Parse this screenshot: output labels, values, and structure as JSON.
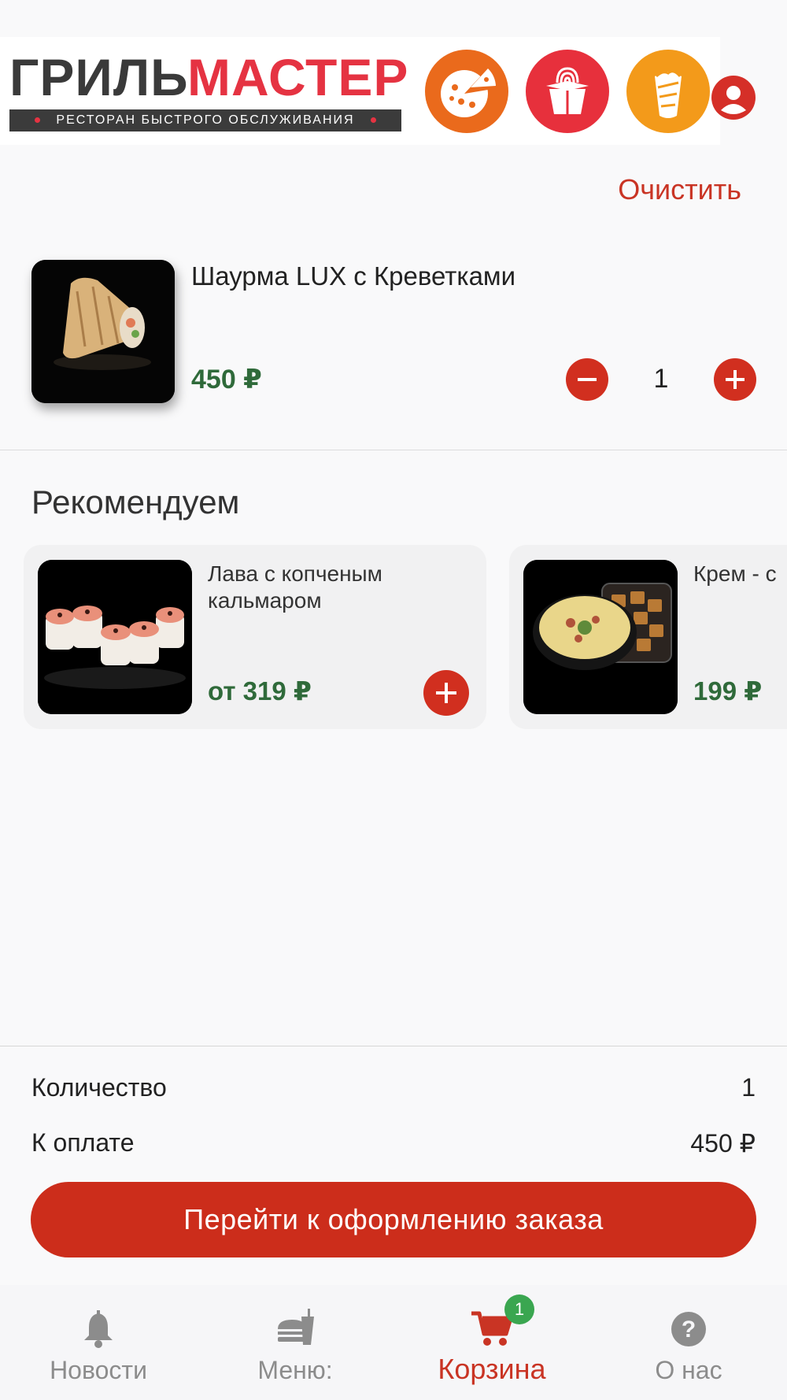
{
  "header": {
    "logo_part1": "ГРИЛЬ",
    "logo_part2": "МАСТЕР",
    "logo_subtitle": "РЕСТОРАН БЫСТРОГО ОБСЛУЖИВАНИЯ",
    "categories": [
      {
        "icon": "pizza-icon",
        "color": "#ea6a1c"
      },
      {
        "icon": "noodle-box-icon",
        "color": "#e7303c"
      },
      {
        "icon": "shawarma-icon",
        "color": "#f39a1a"
      }
    ],
    "profile_icon": "user-icon"
  },
  "cart": {
    "clear_label": "Очистить",
    "items": [
      {
        "name": "Шаурма LUX с Креветками",
        "price": "450 ₽",
        "quantity": "1"
      }
    ]
  },
  "recommend": {
    "title": "Рекомендуем",
    "items": [
      {
        "name": "Лава с копченым кальмаром",
        "price": "от 319 ₽"
      },
      {
        "name": "Крем - с",
        "price": "199 ₽"
      }
    ]
  },
  "summary": {
    "qty_label": "Количество",
    "qty_value": "1",
    "pay_label": "К оплате",
    "pay_value": "450 ₽",
    "checkout_label": "Перейти к оформлению заказа"
  },
  "tabbar": {
    "tabs": [
      {
        "label": "Новости",
        "icon": "bell-icon"
      },
      {
        "label": "Меню:",
        "icon": "burger-drink-icon"
      },
      {
        "label": "Корзина",
        "icon": "cart-icon",
        "active": true,
        "badge": "1"
      },
      {
        "label": "О нас",
        "icon": "help-icon"
      }
    ]
  },
  "colors": {
    "accent": "#cc2d1b",
    "price": "#2f6a3a",
    "badge": "#3aa650"
  }
}
